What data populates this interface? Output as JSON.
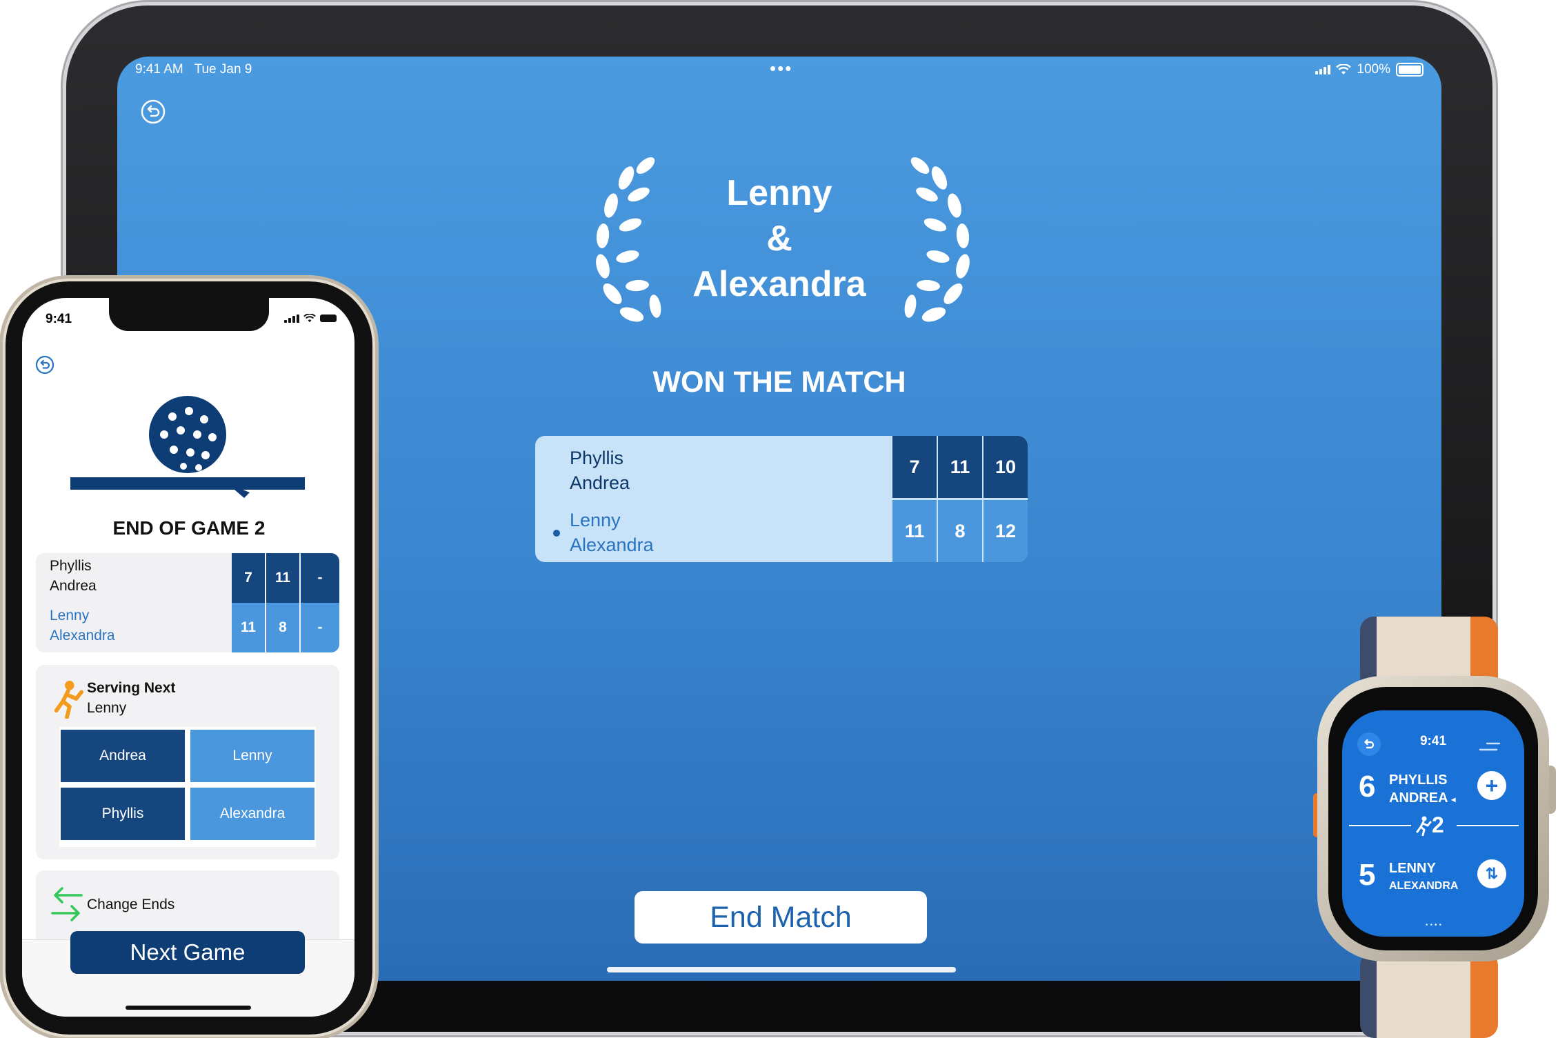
{
  "ipad": {
    "status": {
      "time": "9:41 AM",
      "date": "Tue Jan 9",
      "battery": "100%"
    },
    "winner": {
      "line1": "Lenny",
      "line2": "&",
      "line3": "Alexandra",
      "subtitle": "WON THE MATCH"
    },
    "scoreboard": {
      "team1": {
        "player1": "Phyllis",
        "player2": "Andrea",
        "scores": [
          "7",
          "11",
          "10"
        ]
      },
      "team2": {
        "player1": "Lenny",
        "player2": "Alexandra",
        "scores": [
          "11",
          "8",
          "12"
        ]
      }
    },
    "end_match_label": "End Match"
  },
  "iphone": {
    "status": {
      "time": "9:41"
    },
    "title": "END OF GAME 2",
    "scoreboard": {
      "team1": {
        "player1": "Phyllis",
        "player2": "Andrea",
        "scores": [
          "7",
          "11",
          "-"
        ]
      },
      "team2": {
        "player1": "Lenny",
        "player2": "Alexandra",
        "scores": [
          "11",
          "8",
          "-"
        ]
      }
    },
    "serving": {
      "title": "Serving Next",
      "name": "Lenny"
    },
    "court": {
      "top_left": "Andrea",
      "top_right": "Lenny",
      "bottom_left": "Phyllis",
      "bottom_right": "Alexandra"
    },
    "change_ends_label": "Change Ends",
    "next_game_label": "Next Game"
  },
  "watch": {
    "time": "9:41",
    "team1": {
      "score": "6",
      "player1": "PHYLLIS",
      "player2": "ANDREA"
    },
    "server_number": "2",
    "team2": {
      "score": "5",
      "player1": "LENNY",
      "player2": "ALEXANDRA"
    }
  },
  "colors": {
    "dark_blue": "#15467e",
    "light_blue": "#4b97dd",
    "accent_orange": "#f29b1c",
    "accent_green": "#34c759",
    "watch_blue": "#1a72d6"
  },
  "icons": [
    "undo-icon",
    "laurel-left-icon",
    "laurel-right-icon",
    "pickleball-icon",
    "server-player-icon",
    "swap-arrows-icon",
    "plus-icon",
    "switch-icon",
    "wifi-icon",
    "signal-icon",
    "battery-icon"
  ]
}
